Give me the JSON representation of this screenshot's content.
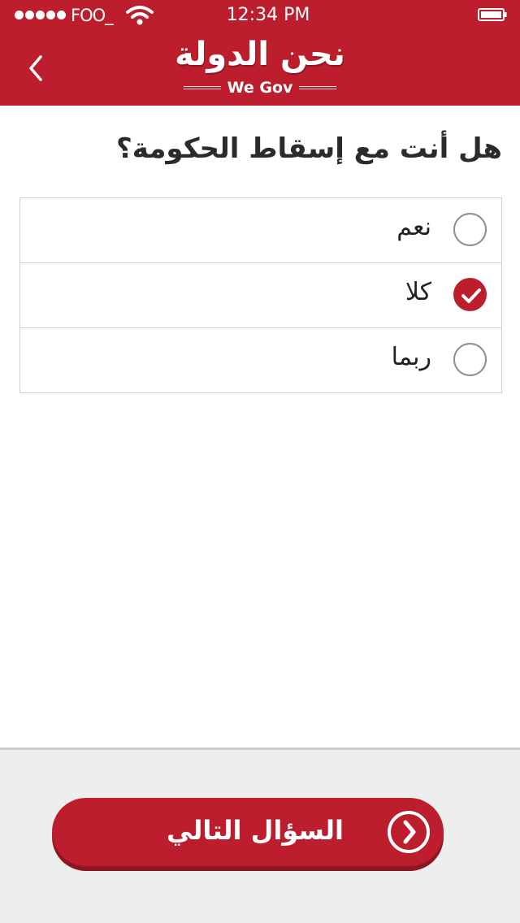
{
  "status_bar": {
    "carrier": "FOO_",
    "time": "12:34 PM"
  },
  "header": {
    "title": "نحن الدولة",
    "subtitle": "We Gov",
    "back_icon": "chevron-left-icon"
  },
  "question": {
    "text": "هل أنت مع إسقاط الحكومة؟"
  },
  "options": [
    {
      "label": "نعم",
      "selected": false
    },
    {
      "label": "كلا",
      "selected": true
    },
    {
      "label": "ربما",
      "selected": false
    }
  ],
  "footer": {
    "next_label": "السؤال التالي",
    "next_icon": "chevron-right-circle-icon"
  },
  "colors": {
    "brand": "#bd1e2d",
    "footer_bg": "#eeeeee"
  }
}
